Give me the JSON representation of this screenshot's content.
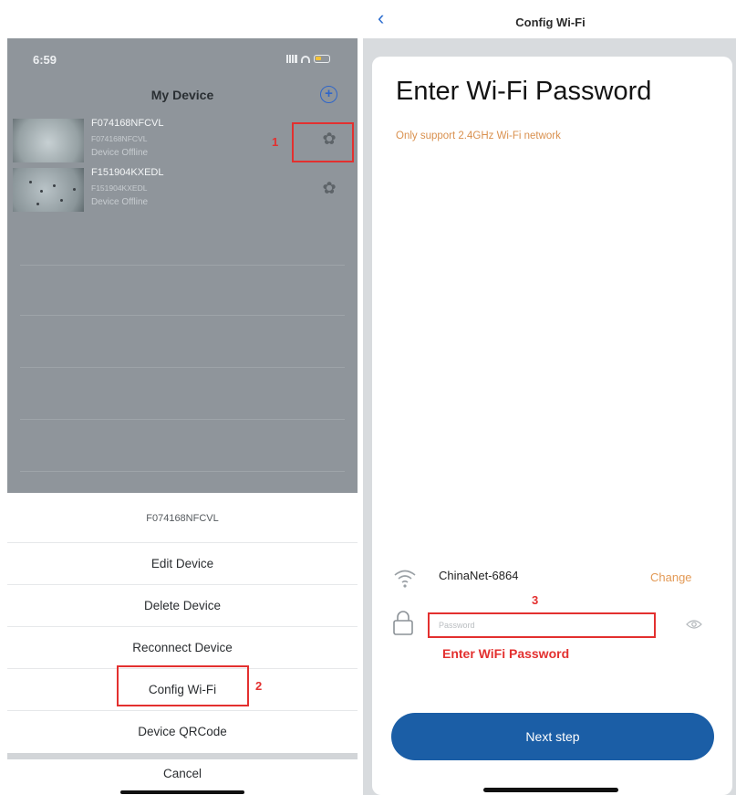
{
  "left": {
    "status_time": "6:59",
    "nav_title": "My Device",
    "add_symbol": "+",
    "devices": [
      {
        "name": "F074168NFCVL",
        "id": "F074168NFCVL",
        "status": "Device Offline"
      },
      {
        "name": "F151904KXEDL",
        "id": "F151904KXEDL",
        "status": "Device Offline"
      }
    ],
    "gear_symbol": "✿",
    "sheet_title": "F074168NFCVL",
    "menu": [
      "Edit Device",
      "Delete Device",
      "Reconnect Device",
      "Config Wi-Fi",
      "Device QRCode"
    ],
    "cancel": "Cancel"
  },
  "annotations": {
    "one": "1",
    "two": "2",
    "three": "3",
    "enter_wifi_password": "Enter WiFi Password"
  },
  "right": {
    "back_symbol": "‹",
    "title": "Config Wi-Fi",
    "heading": "Enter Wi-Fi Password",
    "note": "Only support 2.4GHz Wi-Fi network",
    "ssid": "ChinaNet-6864",
    "change": "Change",
    "password_placeholder": "Password",
    "next": "Next step"
  },
  "colors": {
    "accent": "#1b5ea6",
    "annotation": "#e3302f",
    "warning": "#d9904e",
    "dim_overlay": "#8f959b"
  }
}
